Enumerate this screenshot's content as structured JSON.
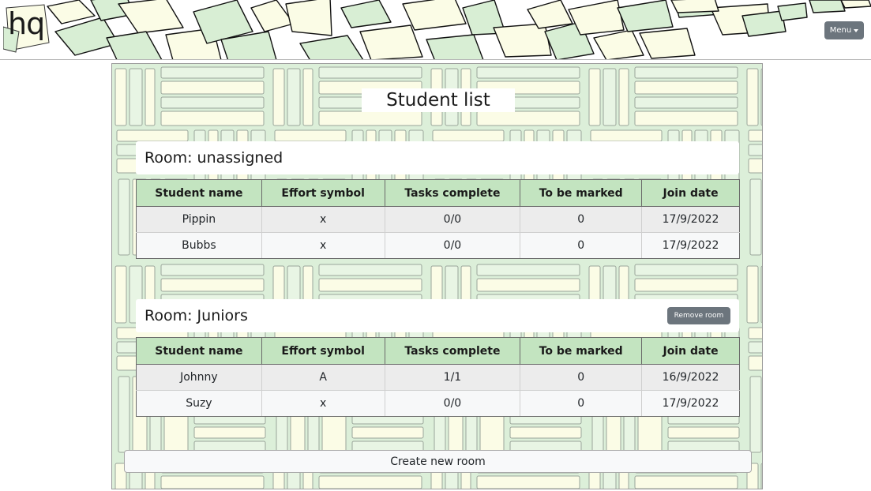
{
  "header": {
    "logo_text": "hq",
    "menu_label": "Menu"
  },
  "page": {
    "title": "Student list"
  },
  "table_headers": [
    "Student name",
    "Effort symbol",
    "Tasks complete",
    "To be marked",
    "Join date"
  ],
  "rooms": [
    {
      "heading": "Room: unassigned",
      "students": [
        {
          "name": "Pippin",
          "effort": "x",
          "tasks": "0/0",
          "marked": "0",
          "joined": "17/9/2022"
        },
        {
          "name": "Bubbs",
          "effort": "x",
          "tasks": "0/0",
          "marked": "0",
          "joined": "17/9/2022"
        }
      ]
    },
    {
      "heading": "Room: Juniors",
      "remove_label": "Remove room",
      "students": [
        {
          "name": "Johnny",
          "effort": "A",
          "tasks": "1/1",
          "marked": "0",
          "joined": "16/9/2022"
        },
        {
          "name": "Suzy",
          "effort": "x",
          "tasks": "0/0",
          "marked": "0",
          "joined": "17/9/2022"
        }
      ]
    }
  ],
  "footer": {
    "create_room_label": "Create new room"
  },
  "colors": {
    "header_green": "#c3e4c0",
    "button_grey": "#6c757d",
    "paper_green": "#d8eed4",
    "paper_cream": "#fbfce6"
  }
}
